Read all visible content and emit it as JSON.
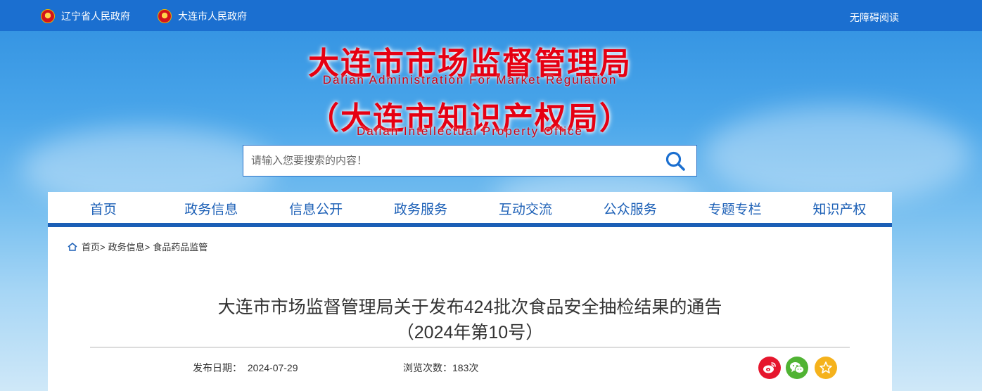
{
  "topbar": {
    "link1": "辽宁省人民政府",
    "link2": "大连市人民政府",
    "accessibility": "无障碍阅读"
  },
  "logo": {
    "cn_line1": "大连市市场监督管理局",
    "en_line1": "Dalian Administration For Market Regulation",
    "cn_line2": "（大连市知识产权局）",
    "en_line2": "Dalian Intellectual Property Office"
  },
  "search": {
    "placeholder": "请输入您要搜索的内容！"
  },
  "nav": {
    "items": [
      "首页",
      "政务信息",
      "信息公开",
      "政务服务",
      "互动交流",
      "公众服务",
      "专题专栏",
      "知识产权"
    ]
  },
  "breadcrumb": {
    "home": "首页>",
    "level1": "政务信息>",
    "level2": "食品药品监管"
  },
  "article": {
    "title_line1": "大连市市场监督管理局关于发布424批次食品安全抽检结果的通告",
    "title_line2": "（2024年第10号）",
    "date_label": "发布日期：",
    "date": "2024-07-29",
    "views": "浏览次数：183次"
  },
  "colors": {
    "topbar": "#1b6fd0",
    "nav_text": "#1b5fb6",
    "logo_red": "#e60012",
    "weibo": "#e6162d",
    "wechat": "#50b333",
    "favorite": "#f5b21c"
  },
  "share_icons": [
    "weibo-icon",
    "wechat-icon",
    "star-icon"
  ]
}
